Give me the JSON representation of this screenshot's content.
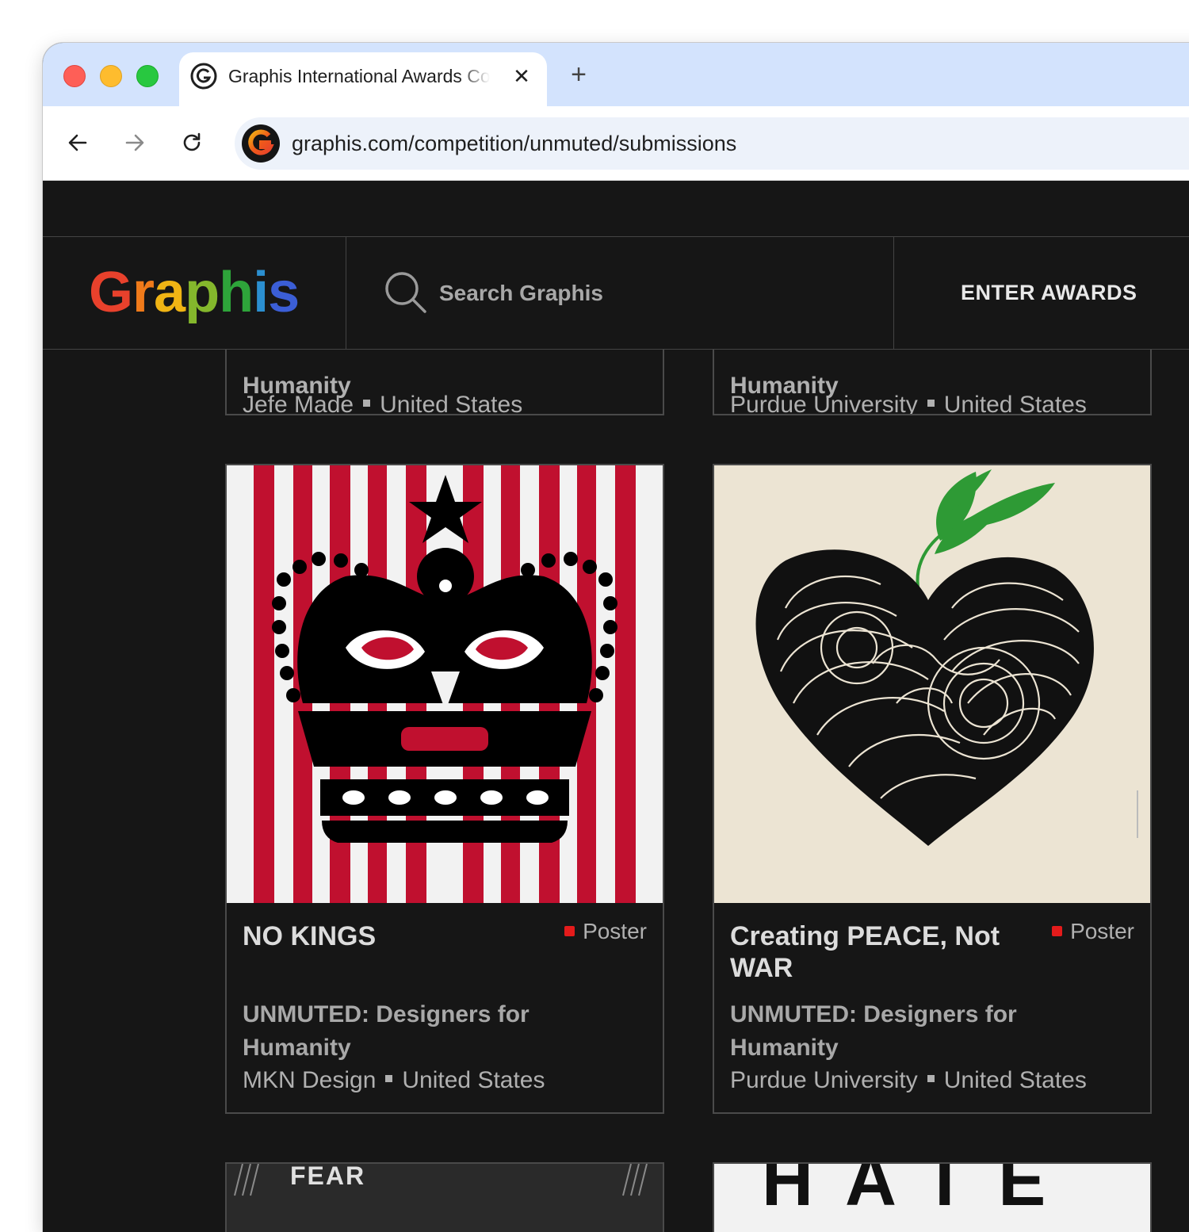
{
  "browser": {
    "tab_title": "Graphis International Awards Competitions",
    "tab_close": "✕",
    "new_tab": "+",
    "url": "graphis.com/competition/unmuted/submissions"
  },
  "header": {
    "logo_letters": [
      "G",
      "r",
      "a",
      "p",
      "h",
      "i",
      "s"
    ],
    "logo_colors": [
      "#e8412c",
      "#ef7a1a",
      "#f0b414",
      "#84b72c",
      "#2ea43a",
      "#2b8fd0",
      "#3b5ed6"
    ],
    "search_placeholder": "Search Graphis",
    "enter_awards": "ENTER AWARDS"
  },
  "top_cards": [
    {
      "cut_title": "Humanity",
      "org": "Jefe Made",
      "country": "United States"
    },
    {
      "cut_title": "Humanity",
      "org": "Purdue University",
      "country": "United States"
    }
  ],
  "cards": [
    {
      "title": "NO KINGS",
      "category": "Poster",
      "competition": "UNMUTED: Designers for Humanity",
      "org": "MKN Design",
      "country": "United States"
    },
    {
      "title": "Creating PEACE, Not WAR",
      "category": "Poster",
      "competition": "UNMUTED: Designers for Humanity",
      "org": "Purdue University",
      "country": "United States"
    }
  ],
  "bottom_cards": [
    {
      "poster_word": "FEAR"
    },
    {
      "poster_word": "HATE"
    }
  ],
  "colors": {
    "page_bg": "#161616",
    "card_border": "#4a4a4a",
    "category_dot": "#e41b1b",
    "poster_red": "#c0102f",
    "leaf_green": "#2e9a35",
    "peace_bg": "#ece4d3"
  }
}
